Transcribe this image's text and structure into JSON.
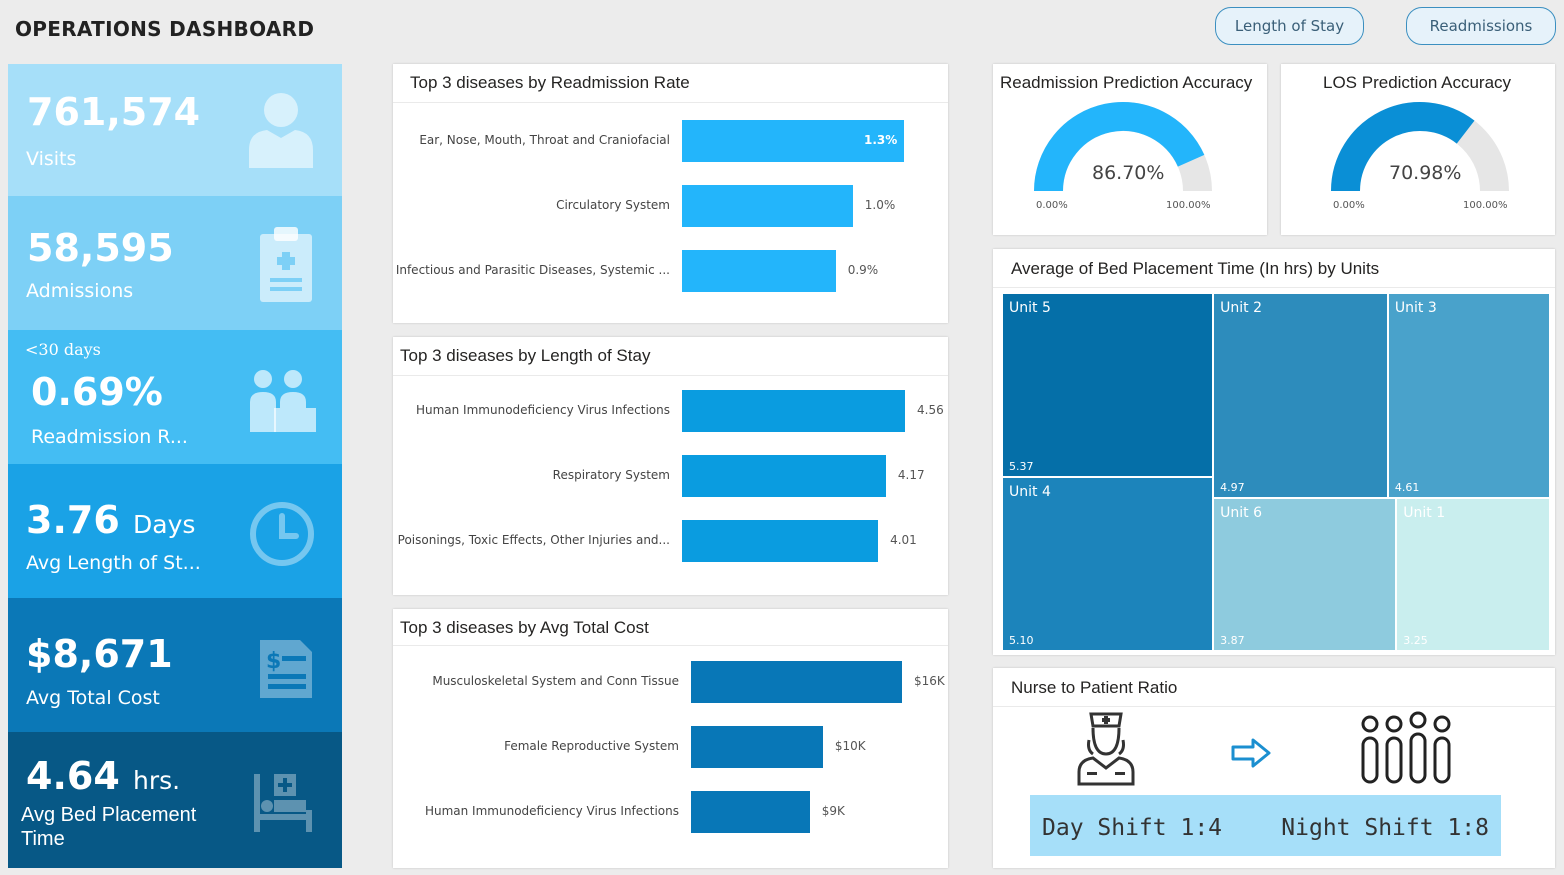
{
  "header": {
    "title": "OPERATIONS DASHBOARD",
    "buttons": [
      "Length of Stay",
      "Readmissions"
    ]
  },
  "kpis": {
    "visits": {
      "value": "761,574",
      "label": "Visits",
      "color": "#a6dff9",
      "icon": "person-icon"
    },
    "admissions": {
      "value": "58,595",
      "label": "Admissions",
      "color": "#7dd0f6",
      "icon": "clipboard-icon"
    },
    "readmission": {
      "prefix": "<30 days",
      "value": "0.69%",
      "label": "Readmission R...",
      "color": "#44bdf3",
      "icon": "doctor-patient-icon"
    },
    "los": {
      "value": "3.76",
      "unit": "Days",
      "label": "Avg Length of St...",
      "color": "#1aa2e6",
      "icon": "clock-icon"
    },
    "cost": {
      "value": "$8,671",
      "label": "Avg Total Cost",
      "color": "#0b78b7",
      "icon": "bill-icon"
    },
    "bed": {
      "value": "4.64",
      "unit": "hrs.",
      "label_line1": "Avg Bed Placement",
      "label_line2": "Time",
      "color": "#075886",
      "icon": "hospital-bed-icon"
    }
  },
  "panels": {
    "readmission_rate": {
      "title": "Top 3 diseases by Readmission Rate"
    },
    "length_of_stay": {
      "title": "Top 3 diseases by Length of Stay"
    },
    "avg_total_cost": {
      "title": "Top 3 diseases by Avg Total Cost"
    },
    "readmission_accuracy": {
      "title": "Readmission Prediction Accuracy"
    },
    "los_accuracy": {
      "title": "LOS Prediction Accuracy"
    },
    "bed_placement": {
      "title": "Average of Bed Placement Time (In hrs) by Units"
    },
    "nurse_ratio": {
      "title": "Nurse to Patient Ratio",
      "day": "Day Shift 1:4",
      "night": "Night Shift 1:8"
    }
  },
  "chart_data": [
    {
      "type": "bar",
      "title": "Top 3 diseases by Readmission Rate",
      "orientation": "horizontal",
      "categories": [
        "Ear, Nose, Mouth, Throat and Craniofacial",
        "Circulatory System",
        "Infectious and Parasitic Diseases, Systemic ..."
      ],
      "values": [
        1.3,
        1.0,
        0.9
      ],
      "labels": [
        "1.3%",
        "1.0%",
        "0.9%"
      ],
      "color": "#23b5fb",
      "grid": false
    },
    {
      "type": "bar",
      "title": "Top 3 diseases by Length of Stay",
      "orientation": "horizontal",
      "categories": [
        "Human Immunodeficiency Virus Infections",
        "Respiratory System",
        "Poisonings, Toxic Effects, Other Injuries and..."
      ],
      "values": [
        4.56,
        4.17,
        4.01
      ],
      "labels": [
        "4.56",
        "4.17",
        "4.01"
      ],
      "color": "#0a9ce0",
      "grid": false
    },
    {
      "type": "bar",
      "title": "Top 3 diseases by Avg Total Cost",
      "orientation": "horizontal",
      "categories": [
        "Musculoskeletal System and Conn Tissue",
        "Female Reproductive System",
        "Human Immunodeficiency Virus Infections"
      ],
      "values": [
        16,
        10,
        9
      ],
      "labels": [
        "$16K",
        "$10K",
        "$9K"
      ],
      "color": "#0877b7",
      "grid": false
    },
    {
      "type": "gauge",
      "title": "Readmission Prediction Accuracy",
      "value": 86.7,
      "value_label": "86.70%",
      "min_label": "0.00%",
      "max_label": "100.00%",
      "range": [
        0,
        100
      ],
      "color": "#23b5fb"
    },
    {
      "type": "gauge",
      "title": "LOS Prediction Accuracy",
      "value": 70.98,
      "value_label": "70.98%",
      "min_label": "0.00%",
      "max_label": "100.00%",
      "range": [
        0,
        100
      ],
      "color": "#0a8fd6"
    },
    {
      "type": "treemap",
      "title": "Average of Bed Placement Time (In hrs) by Units",
      "items": [
        {
          "name": "Unit 5",
          "value": 5.37,
          "label": "5.37",
          "color": "#056fa8"
        },
        {
          "name": "Unit 4",
          "value": 5.1,
          "label": "5.10",
          "color": "#1c84bb"
        },
        {
          "name": "Unit 2",
          "value": 4.97,
          "label": "4.97",
          "color": "#2d8cbc"
        },
        {
          "name": "Unit 3",
          "value": 4.61,
          "label": "4.61",
          "color": "#49a2cb"
        },
        {
          "name": "Unit 6",
          "value": 3.87,
          "label": "3.87",
          "color": "#8ecbde"
        },
        {
          "name": "Unit 1",
          "value": 3.25,
          "label": "3.25",
          "color": "#c9eeee"
        }
      ]
    }
  ]
}
